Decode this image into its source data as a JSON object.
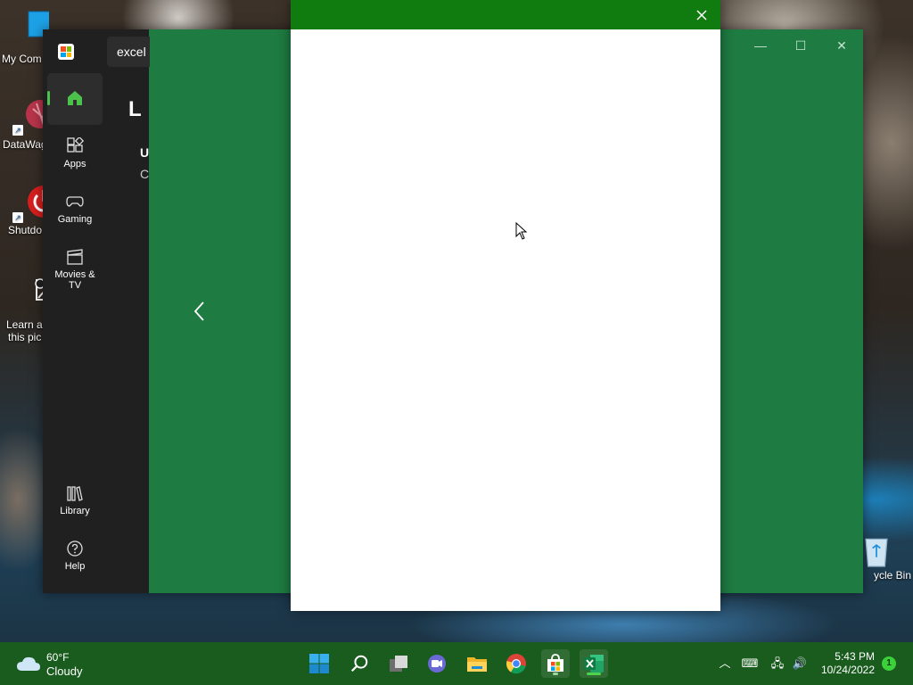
{
  "desktop": {
    "icons": [
      {
        "label": "My Com"
      },
      {
        "label": "DataWag"
      },
      {
        "label": "Shutdo"
      },
      {
        "label_line1": "Learn al",
        "label_line2": "this pic"
      }
    ],
    "recycle_bin_label": "ycle Bin"
  },
  "store": {
    "search_value": "excel",
    "peek_title": "L",
    "peek_line1": "U",
    "peek_line2": "C",
    "nav": [
      {
        "label": "",
        "icon": "home-icon",
        "active": true
      },
      {
        "label": "Apps",
        "icon": "apps-icon"
      },
      {
        "label": "Gaming",
        "icon": "gamepad-icon"
      },
      {
        "label": "Movies & TV",
        "icon": "clapperboard-icon"
      },
      {
        "label": "Library",
        "icon": "library-icon"
      },
      {
        "label": "Help",
        "icon": "help-icon"
      }
    ],
    "accent_color": "#1e7b42"
  },
  "dialog": {
    "titlebar_color": "#107c10",
    "close_icon": "close-icon"
  },
  "taskbar": {
    "weather": {
      "temp": "60°F",
      "condition": "Cloudy"
    },
    "pinned": [
      "start-icon",
      "search-icon",
      "task-view-icon",
      "teams-chat-icon",
      "file-explorer-icon",
      "chrome-icon",
      "ms-store-icon",
      "excel-icon"
    ],
    "clock": {
      "time": "5:43 PM",
      "date": "10/24/2022"
    },
    "notification_count": "1"
  }
}
